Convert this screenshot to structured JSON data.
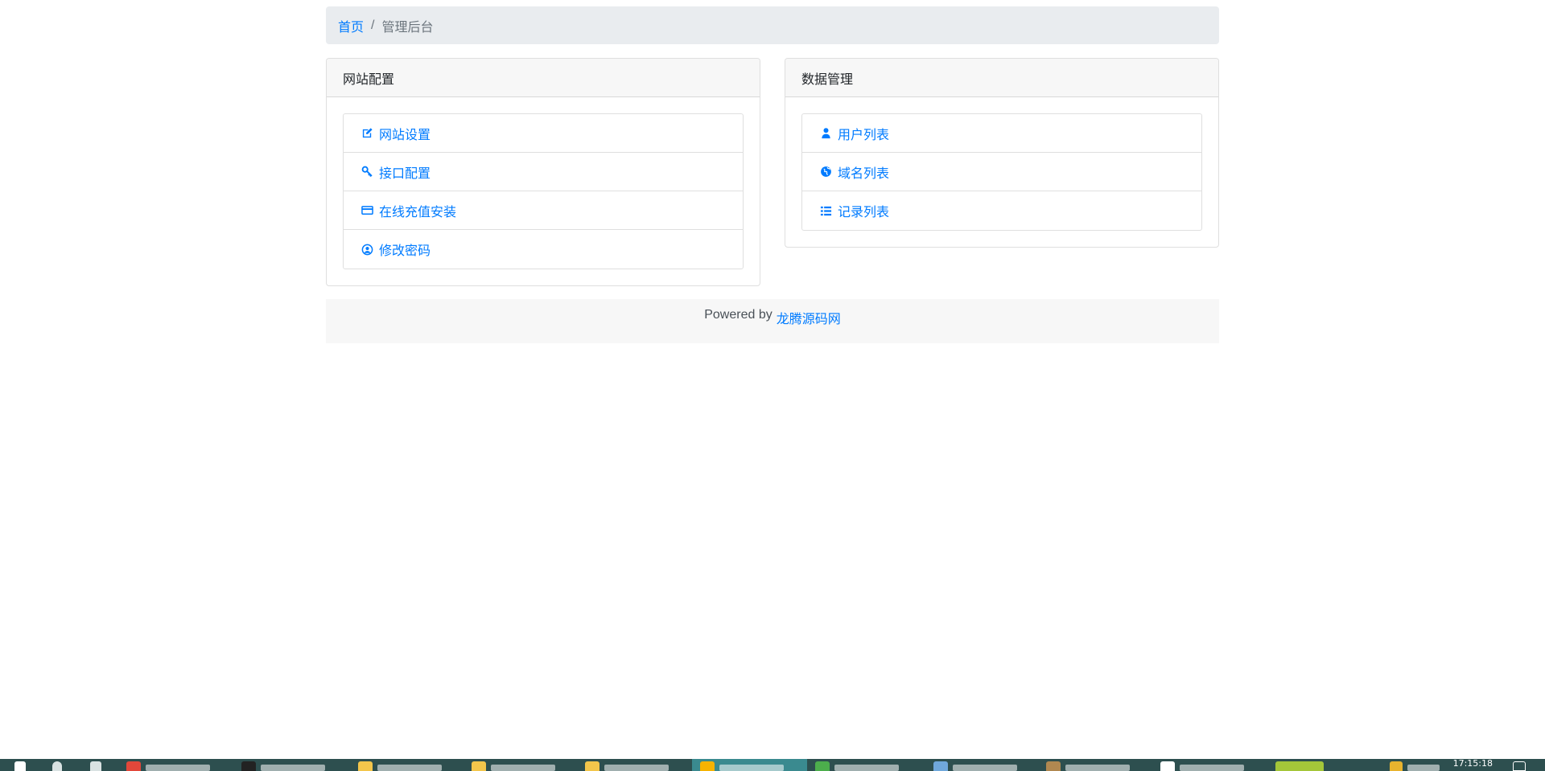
{
  "breadcrumb": {
    "home": "首页",
    "separator": "/",
    "current": "管理后台"
  },
  "cards": [
    {
      "title": "网站配置",
      "items": [
        {
          "label": "网站设置",
          "icon": "edit-icon"
        },
        {
          "label": "接口配置",
          "icon": "key-icon"
        },
        {
          "label": "在线充值安装",
          "icon": "credit-card-icon"
        },
        {
          "label": "修改密码",
          "icon": "user-circle-icon"
        }
      ]
    },
    {
      "title": "数据管理",
      "items": [
        {
          "label": "用户列表",
          "icon": "user-icon"
        },
        {
          "label": "域名列表",
          "icon": "globe-icon"
        },
        {
          "label": "记录列表",
          "icon": "list-icon"
        }
      ]
    }
  ],
  "footer": {
    "text": "Powered by",
    "link": "龙腾源码网"
  },
  "taskbar": {
    "clock": "17:15:18"
  },
  "colors": {
    "link": "#007bff",
    "breadcrumb_bg": "#e9ecef",
    "header_bg": "#f7f7f7",
    "taskbar_bg": "#2d4f4f"
  }
}
